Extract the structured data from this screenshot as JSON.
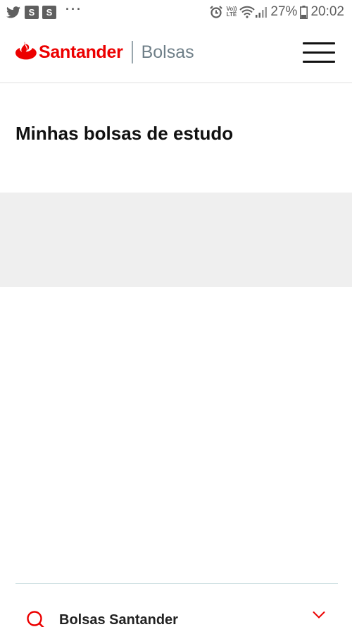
{
  "status_bar": {
    "s_badges": [
      "S",
      "S"
    ],
    "more_dots": "···",
    "volte_top": "Vo))",
    "volte_bottom": "LTE",
    "battery_percent": "27%",
    "time": "20:02"
  },
  "header": {
    "brand_name": "Santander",
    "product_name": "Bolsas"
  },
  "main": {
    "title": "Minhas bolsas de estudo"
  },
  "footer": {
    "accordion_label": "Bolsas Santander"
  },
  "colors": {
    "brand_red": "#ec0000",
    "panel_gray": "#efefef"
  },
  "icons": {
    "status_left": [
      "twitter-icon",
      "s-icon",
      "s-icon",
      "more-dots-icon"
    ],
    "status_right": [
      "alarm-icon",
      "volte-icon",
      "wifi-icon",
      "signal-icon",
      "battery-icon"
    ],
    "header": [
      "santander-flame-icon",
      "hamburger-menu-icon"
    ],
    "footer": [
      "search-icon",
      "chevron-down-icon"
    ]
  }
}
